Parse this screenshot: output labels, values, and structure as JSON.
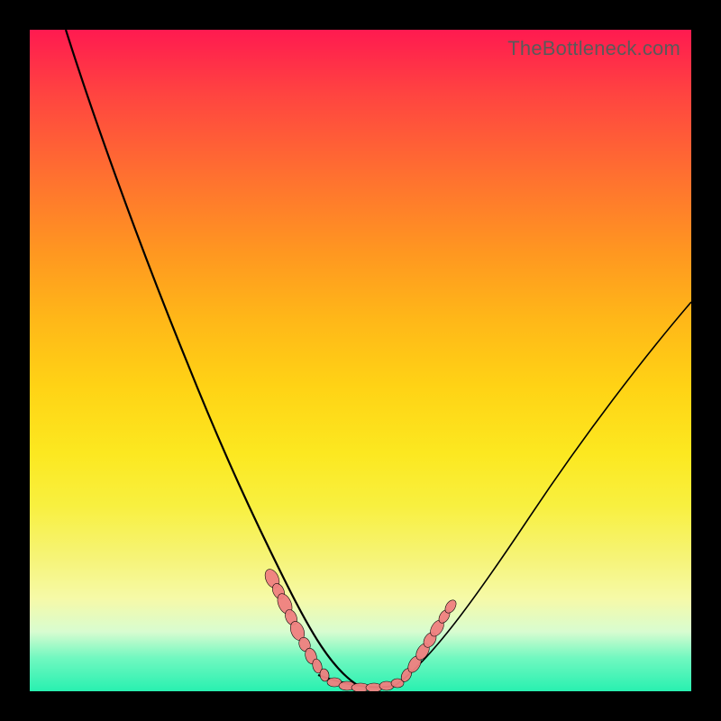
{
  "watermark": "TheBottleneck.com",
  "chart_data": {
    "type": "line",
    "title": "",
    "xlabel": "",
    "ylabel": "",
    "xlim": [
      0,
      100
    ],
    "ylim": [
      0,
      100
    ],
    "series": [
      {
        "name": "bottleneck-curve",
        "x": [
          5,
          10,
          15,
          20,
          25,
          30,
          34,
          38,
          41,
          44,
          47,
          50,
          54,
          58,
          63,
          70,
          80,
          90,
          100
        ],
        "y": [
          100,
          84,
          68,
          54,
          42,
          31,
          22,
          15,
          9,
          4,
          1,
          0,
          1,
          5,
          12,
          22,
          36,
          49,
          59
        ]
      }
    ],
    "markers": {
      "left_cluster": [
        {
          "x": 37.0,
          "y": 17.5
        },
        {
          "x": 37.8,
          "y": 15.5
        },
        {
          "x": 38.6,
          "y": 13.2
        },
        {
          "x": 39.2,
          "y": 11.5
        },
        {
          "x": 40.2,
          "y": 9.5
        },
        {
          "x": 41.0,
          "y": 7.0
        },
        {
          "x": 42.0,
          "y": 5.5
        },
        {
          "x": 42.8,
          "y": 4.0
        },
        {
          "x": 43.6,
          "y": 2.8
        }
      ],
      "bottom_cluster": [
        {
          "x": 45.0,
          "y": 1.3
        },
        {
          "x": 46.5,
          "y": 0.6
        },
        {
          "x": 48.0,
          "y": 0.3
        },
        {
          "x": 49.5,
          "y": 0.2
        },
        {
          "x": 51.0,
          "y": 0.2
        },
        {
          "x": 52.5,
          "y": 0.4
        },
        {
          "x": 54.0,
          "y": 0.8
        },
        {
          "x": 55.0,
          "y": 1.3
        }
      ],
      "right_cluster": [
        {
          "x": 56.2,
          "y": 2.8
        },
        {
          "x": 57.5,
          "y": 4.5
        },
        {
          "x": 58.8,
          "y": 6.5
        },
        {
          "x": 59.8,
          "y": 8.0
        },
        {
          "x": 61.0,
          "y": 9.8
        },
        {
          "x": 62.2,
          "y": 11.5
        },
        {
          "x": 63.0,
          "y": 13.0
        }
      ]
    },
    "gradient_colors": {
      "top": "#ff1a50",
      "mid": "#ffd315",
      "bottom": "#28f0b0"
    }
  }
}
